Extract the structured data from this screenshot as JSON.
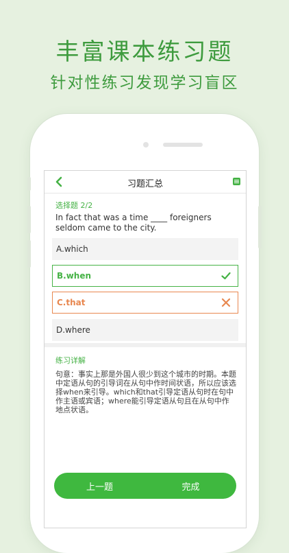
{
  "promo": {
    "title": "丰富课本练习题",
    "subtitle": "针对性练习发现学习盲区"
  },
  "screen": {
    "nav_title": "习题汇总",
    "question_label": "选择题 2/2",
    "question_text": "In fact that was a time ____ foreigners seldom came to the city.",
    "options": [
      {
        "label": "A.which",
        "state": "normal"
      },
      {
        "label": "B.when",
        "state": "correct",
        "icon": "check-icon"
      },
      {
        "label": "C.that",
        "state": "wrong",
        "icon": "cross-icon"
      },
      {
        "label": "D.where",
        "state": "normal"
      }
    ],
    "explanation_label": "练习详解",
    "explanation_text": "句意：事实上那是外国人很少到这个城市的时期。本题中定语从句的引导词在从句中作时间状语，所以应该选择when来引导。which和that引导定语从句时在句中作主语或宾语；where能引导定语从句且在从句中作地点状语。",
    "prev_label": "上一题",
    "finish_label": "完成"
  },
  "colors": {
    "accent": "#45b245",
    "wrong": "#e8874f",
    "background": "#e6f1e0"
  }
}
